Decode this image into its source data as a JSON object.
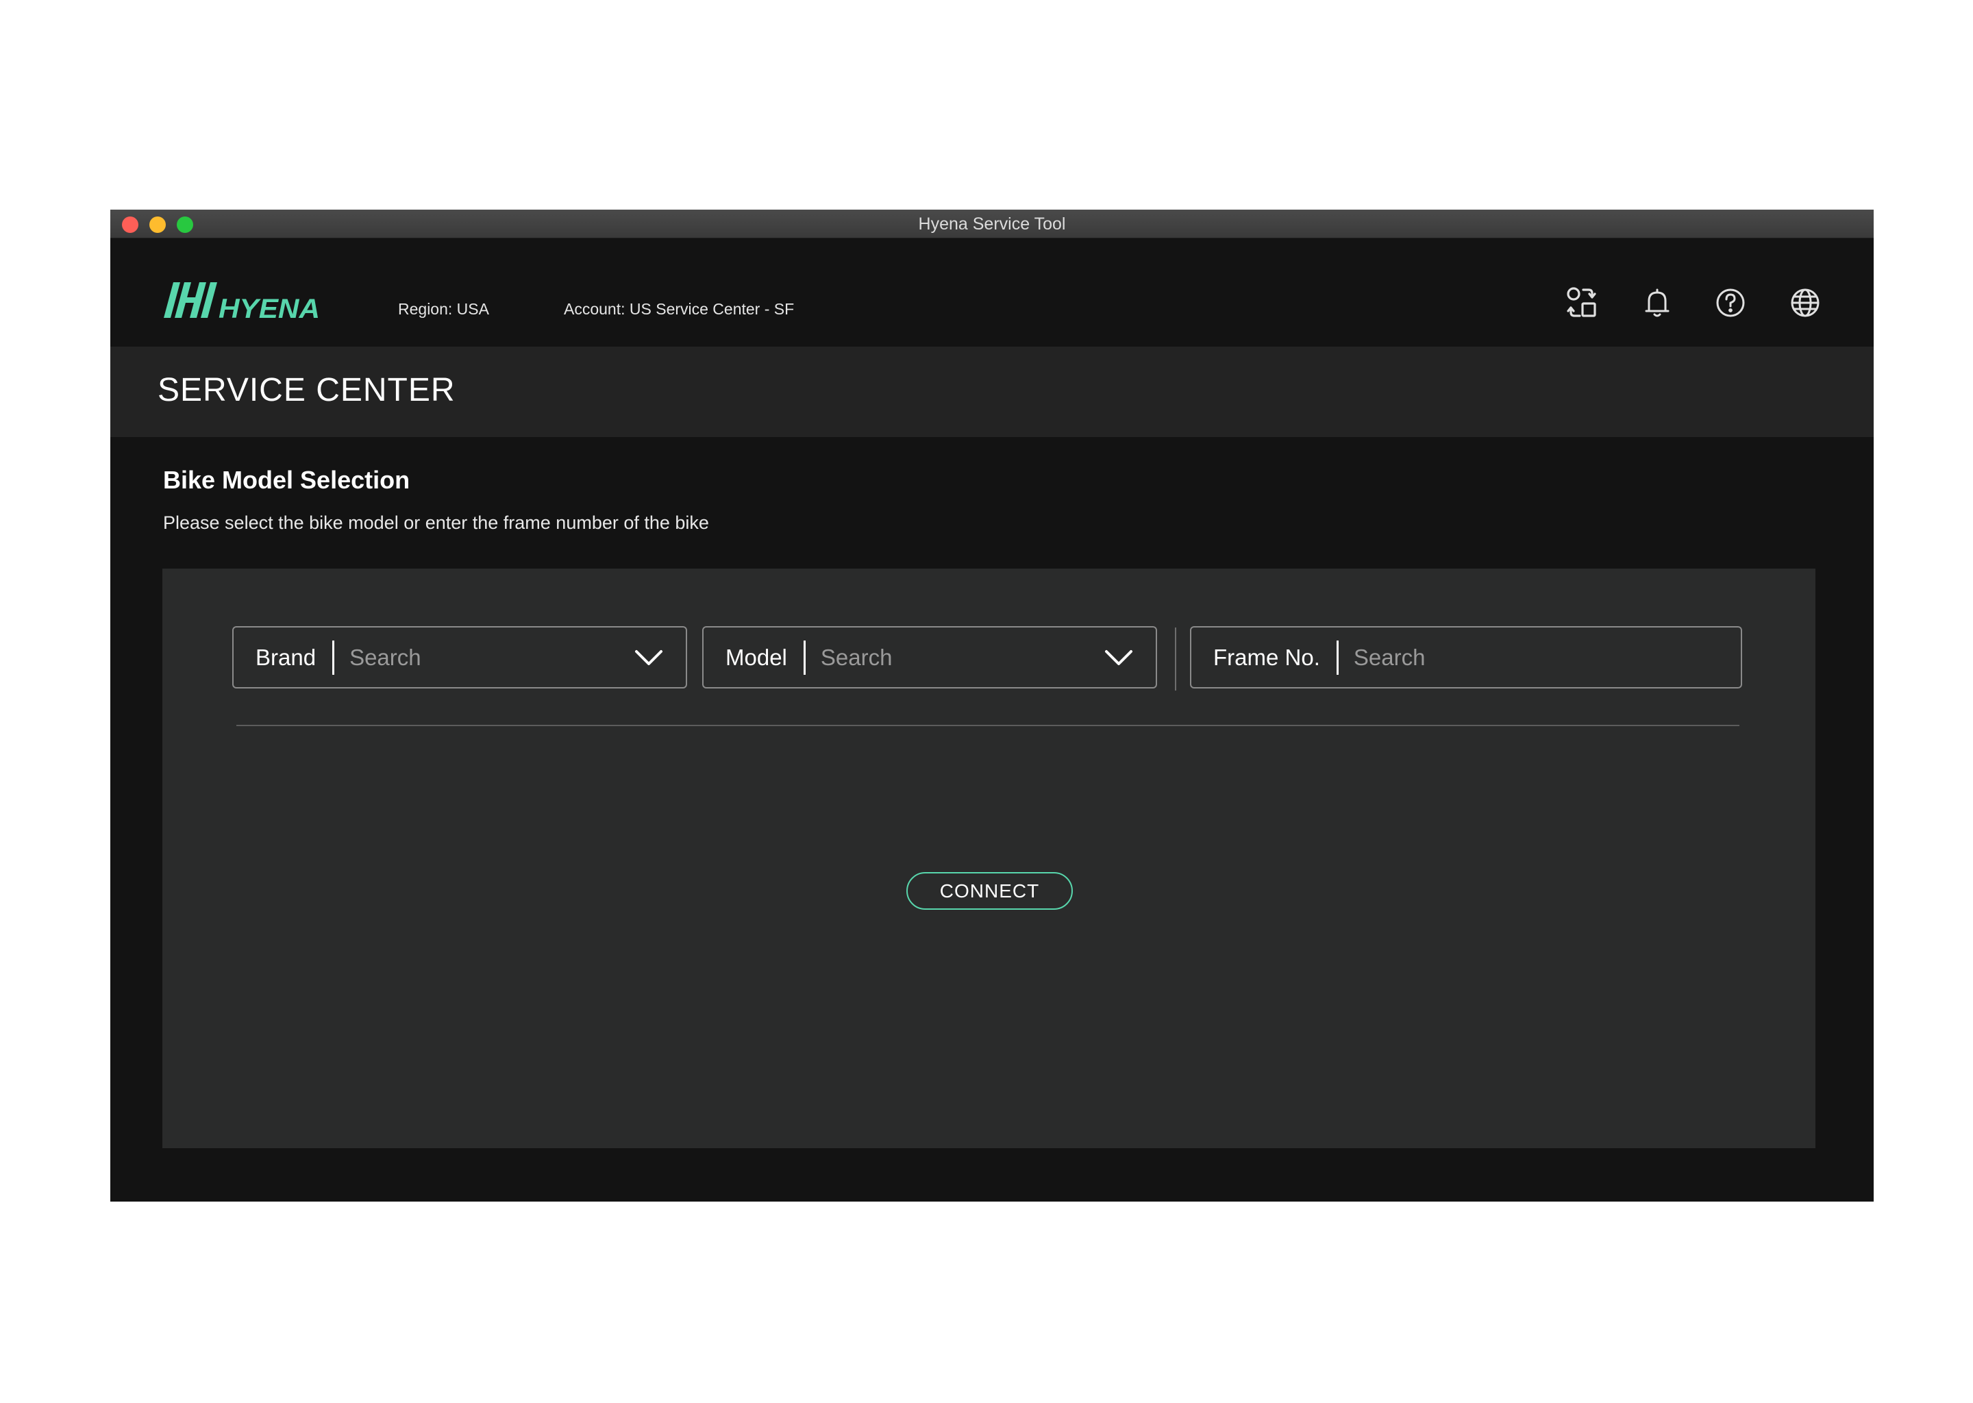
{
  "window": {
    "title": "Hyena Service Tool"
  },
  "header": {
    "logo_text": "HYENA",
    "region": "Region: USA",
    "account": "Account: US Service Center - SF",
    "icons": [
      "switch-account-icon",
      "bell-icon",
      "help-icon",
      "globe-icon"
    ]
  },
  "section": {
    "title": "SERVICE CENTER"
  },
  "content": {
    "heading": "Bike Model Selection",
    "subtitle": "Please select the bike model or enter the frame number of the bike"
  },
  "filters": {
    "brand": {
      "label": "Brand",
      "placeholder": "Search",
      "value": ""
    },
    "model": {
      "label": "Model",
      "placeholder": "Search",
      "value": ""
    },
    "frame": {
      "label": "Frame No.",
      "placeholder": "Search",
      "value": ""
    }
  },
  "actions": {
    "connect_label": "CONNECT"
  },
  "colors": {
    "accent": "#58d6ac",
    "background": "#131313",
    "banner": "#232323",
    "panel": "#2a2b2b"
  }
}
